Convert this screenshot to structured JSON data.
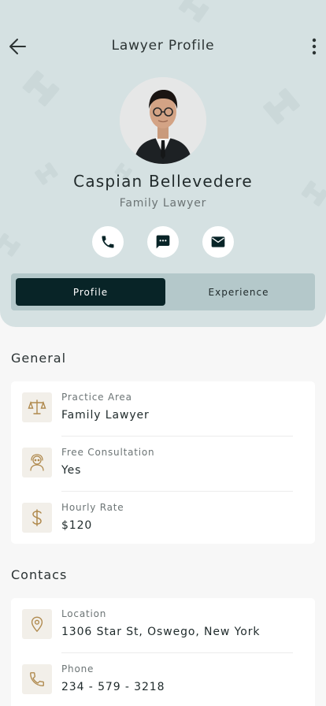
{
  "header": {
    "title": "Lawyer Profile"
  },
  "profile": {
    "name": "Caspian Bellevedere",
    "specialty": "Family Lawyer",
    "actions": [
      {
        "icon": "phone-icon"
      },
      {
        "icon": "message-icon"
      },
      {
        "icon": "mail-icon"
      }
    ]
  },
  "tabs": [
    {
      "label": "Profile",
      "active": true
    },
    {
      "label": "Experience",
      "active": false
    }
  ],
  "general": {
    "title": "General",
    "items": [
      {
        "icon": "scale-icon",
        "label": "Practice Area",
        "value": "Family Lawyer"
      },
      {
        "icon": "consultant-icon",
        "label": "Free Consultation",
        "value": "Yes"
      },
      {
        "icon": "dollar-icon",
        "label": "Hourly Rate",
        "value": "$120"
      }
    ]
  },
  "contacts": {
    "title": "Contacs",
    "items": [
      {
        "icon": "location-pin-icon",
        "label": "Location",
        "value": "1306 Star St, Oswego, New York"
      },
      {
        "icon": "phone-icon",
        "label": "Phone",
        "value": "234 - 579 - 3218"
      }
    ]
  },
  "colors": {
    "header_bg": "#d5e1e2",
    "accent_dark": "#082427",
    "tab_track": "#b4c8ca",
    "icon_gold": "#b08a4e"
  }
}
